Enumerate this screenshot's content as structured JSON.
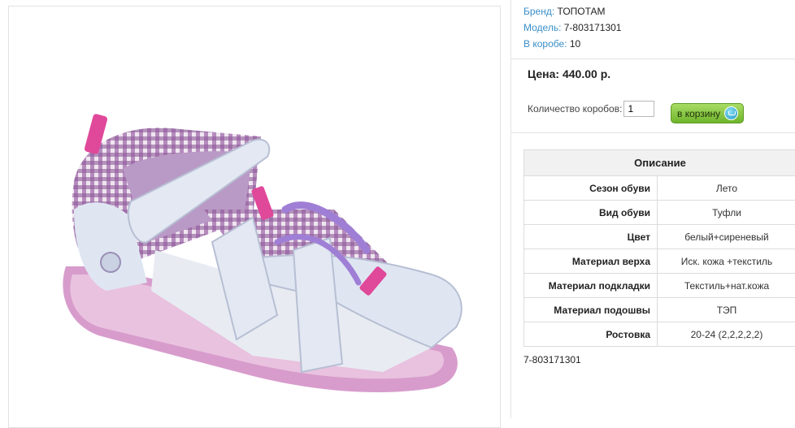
{
  "specs": [
    {
      "label": "Бренд:",
      "value": "ТОПОТАМ"
    },
    {
      "label": "Модель:",
      "value": "7-803171301"
    },
    {
      "label": "В коробе:",
      "value": "10"
    }
  ],
  "price_text": "Цена: 440.00 р.",
  "quantity": {
    "label": "Количество коробов:",
    "value": "1"
  },
  "cart_button_label": "в корзину",
  "description": {
    "header": "Описание",
    "rows": [
      {
        "key": "Сезон обуви",
        "value": "Лето"
      },
      {
        "key": "Вид обуви",
        "value": "Туфли"
      },
      {
        "key": "Цвет",
        "value": "белый+сиреневый"
      },
      {
        "key": "Материал верха",
        "value": "Иск. кожа +текстиль"
      },
      {
        "key": "Материал подкладки",
        "value": "Текстиль+нат.кожа"
      },
      {
        "key": "Материал подошвы",
        "value": "ТЭП"
      },
      {
        "key": "Ростовка",
        "value": "20-24 (2,2,2,2,2)"
      }
    ]
  },
  "sku_text": "7-803171301",
  "colors": {
    "label_blue": "#3a8fc8",
    "button_green": "#6fb52c",
    "cart_icon": "#1d97c4"
  }
}
